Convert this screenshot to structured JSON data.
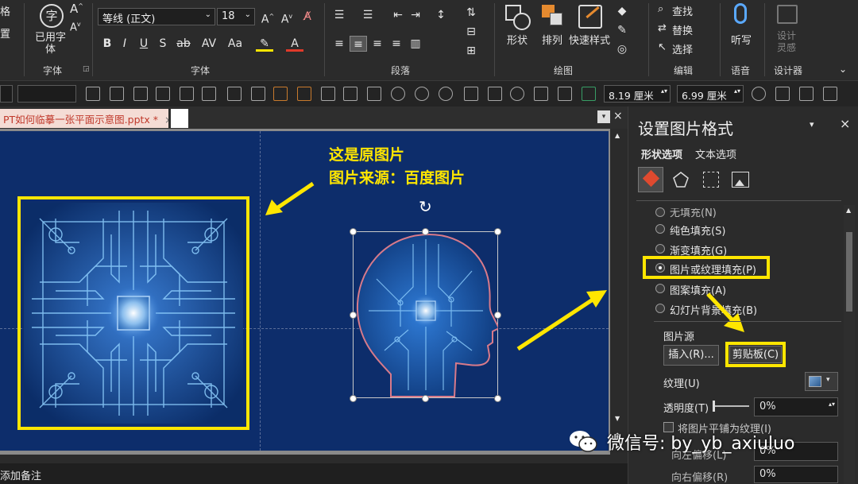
{
  "ribbon": {
    "left_cut_1": "格",
    "left_cut_2": "置",
    "font_group_label": "字体",
    "font_group_label_2": "字体",
    "used_fonts_label": "已用字\n体",
    "used_fonts_line1": "已用字",
    "used_fonts_line2": "体",
    "font_name": "等线 (正文)",
    "font_size": "18",
    "bold": "B",
    "italic": "I",
    "underline": "U",
    "strike": "S",
    "spacing": "AV",
    "case": "Aa",
    "paragraph_label": "段落",
    "drawing_label": "绘图",
    "shape_label": "形状",
    "arrange_label": "排列",
    "quickstyle_label": "快速样式",
    "edit_label": "编辑",
    "find_label": "查找",
    "replace_label": "替换",
    "select_label": "选择",
    "voice_label": "语音",
    "dictate_label": "听写",
    "designer_label": "设计器",
    "design_ideas_line1": "设计",
    "design_ideas_line2": "灵感"
  },
  "toolbar": {
    "height_value": "8.19 厘米",
    "width_value": "6.99 厘米"
  },
  "tab": {
    "filename": "PT如何临摹一张平面示意图.pptx *",
    "close": "×"
  },
  "slide": {
    "annotation_line1": "这是原图片",
    "annotation_line2": "图片来源：百度图片"
  },
  "notes": {
    "placeholder": "添加备注"
  },
  "panel": {
    "title": "设置图片格式",
    "tab_shape": "形状选项",
    "tab_text": "文本选项",
    "fill_none": "无填充(N)",
    "fill_solid": "纯色填充(S)",
    "fill_gradient": "渐变填充(G)",
    "fill_picture": "图片或纹理填充(P)",
    "fill_pattern": "图案填充(A)",
    "fill_slide_bg": "幻灯片背景填充(B)",
    "picture_source": "图片源",
    "insert_btn": "插入(R)...",
    "clipboard_btn": "剪贴板(C)",
    "texture_label": "纹理(U)",
    "transparency_label": "透明度(T)",
    "transparency_value": "0%",
    "tile_label": "将图片平铺为纹理(I)",
    "offset_left": "向左偏移(L)",
    "offset_left_value": "0%",
    "offset_right": "向右偏移(R)",
    "offset_right_value": "0%"
  },
  "watermark": {
    "text": "微信号: by_yb_axiuluo"
  },
  "colors": {
    "accent_yellow": "#ffe600",
    "slide_bg": "#0d2d6b",
    "circuit": "#5fb4ff"
  }
}
